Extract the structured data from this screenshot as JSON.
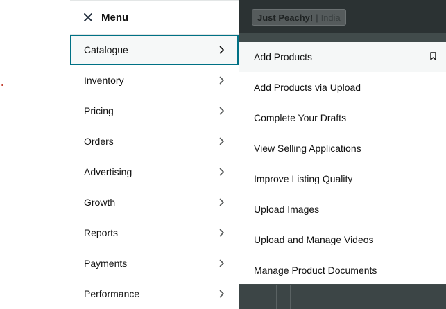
{
  "app": {
    "store_name": "Just Peachy!",
    "separator": "|",
    "region": "India"
  },
  "menu": {
    "title": "Menu",
    "items": [
      {
        "label": "Catalogue",
        "active": true
      },
      {
        "label": "Inventory"
      },
      {
        "label": "Pricing"
      },
      {
        "label": "Orders"
      },
      {
        "label": "Advertising"
      },
      {
        "label": "Growth"
      },
      {
        "label": "Reports"
      },
      {
        "label": "Payments"
      },
      {
        "label": "Performance"
      }
    ]
  },
  "submenu": {
    "parent": "Catalogue",
    "items": [
      {
        "label": "Add Products",
        "bookmark_icon": "bookmark-icon"
      },
      {
        "label": "Add Products via Upload"
      },
      {
        "label": "Complete Your Drafts"
      },
      {
        "label": "View Selling Applications"
      },
      {
        "label": "Improve Listing Quality"
      },
      {
        "label": "Upload Images"
      },
      {
        "label": "Upload and Manage Videos"
      },
      {
        "label": "Manage Product Documents"
      }
    ]
  },
  "colors": {
    "accent": "#007185",
    "header_dark": "#2b3233",
    "text": "#111111"
  }
}
